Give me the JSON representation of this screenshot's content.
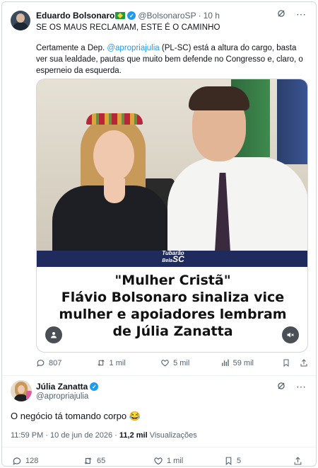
{
  "quoted": {
    "name": "Eduardo Bolsonaro",
    "handle": "@BolsonaroSP",
    "separator": "·",
    "time": "10 h",
    "headline": "SE OS MAUS RECLAMAM, ESTE É O CAMINHO",
    "body_prefix": "Certamente a Dep. ",
    "body_mention": "@apropriajulia",
    "body_suffix": " (PL-SC) está a altura do cargo, basta ver sua lealdade, pautas que muito bem defende no Congresso e, claro, o esperneio da esquerda.",
    "media": {
      "logo_line1": "Tubarão",
      "logo_line2_prefix": "Bela",
      "logo_line2_bold": "SC",
      "caption_line1": "\"Mulher Cristã\"",
      "caption_line2": "Flávio Bolsonaro sinaliza vice",
      "caption_line3": "mulher e apoiadores lembram",
      "caption_line4": "de Júlia Zanatta"
    },
    "actions": {
      "replies": "807",
      "reposts": "1 mil",
      "likes": "5 mil",
      "views": "59 mil"
    }
  },
  "main": {
    "name": "Júlia Zanatta",
    "handle": "@apropriajulia",
    "text": "O negócio tá tomando corpo 😂",
    "meta_time": "11:59 PM · 10 de jun de 2026 · ",
    "meta_views": "11,2 mil",
    "meta_views_label": " Visualizações",
    "actions": {
      "replies": "128",
      "reposts": "65",
      "likes": "1 mil",
      "bookmarks": "5"
    }
  },
  "icons": {
    "verified": "verified-badge-icon",
    "grok": "grok-icon",
    "more": "more-icon",
    "reply": "reply-icon",
    "repost": "repost-icon",
    "like": "like-icon",
    "views": "views-icon",
    "bookmark": "bookmark-icon",
    "share": "share-icon"
  },
  "colors": {
    "accent": "#1d9bf0",
    "muted": "#536471",
    "banner": "#1f2b5c"
  }
}
